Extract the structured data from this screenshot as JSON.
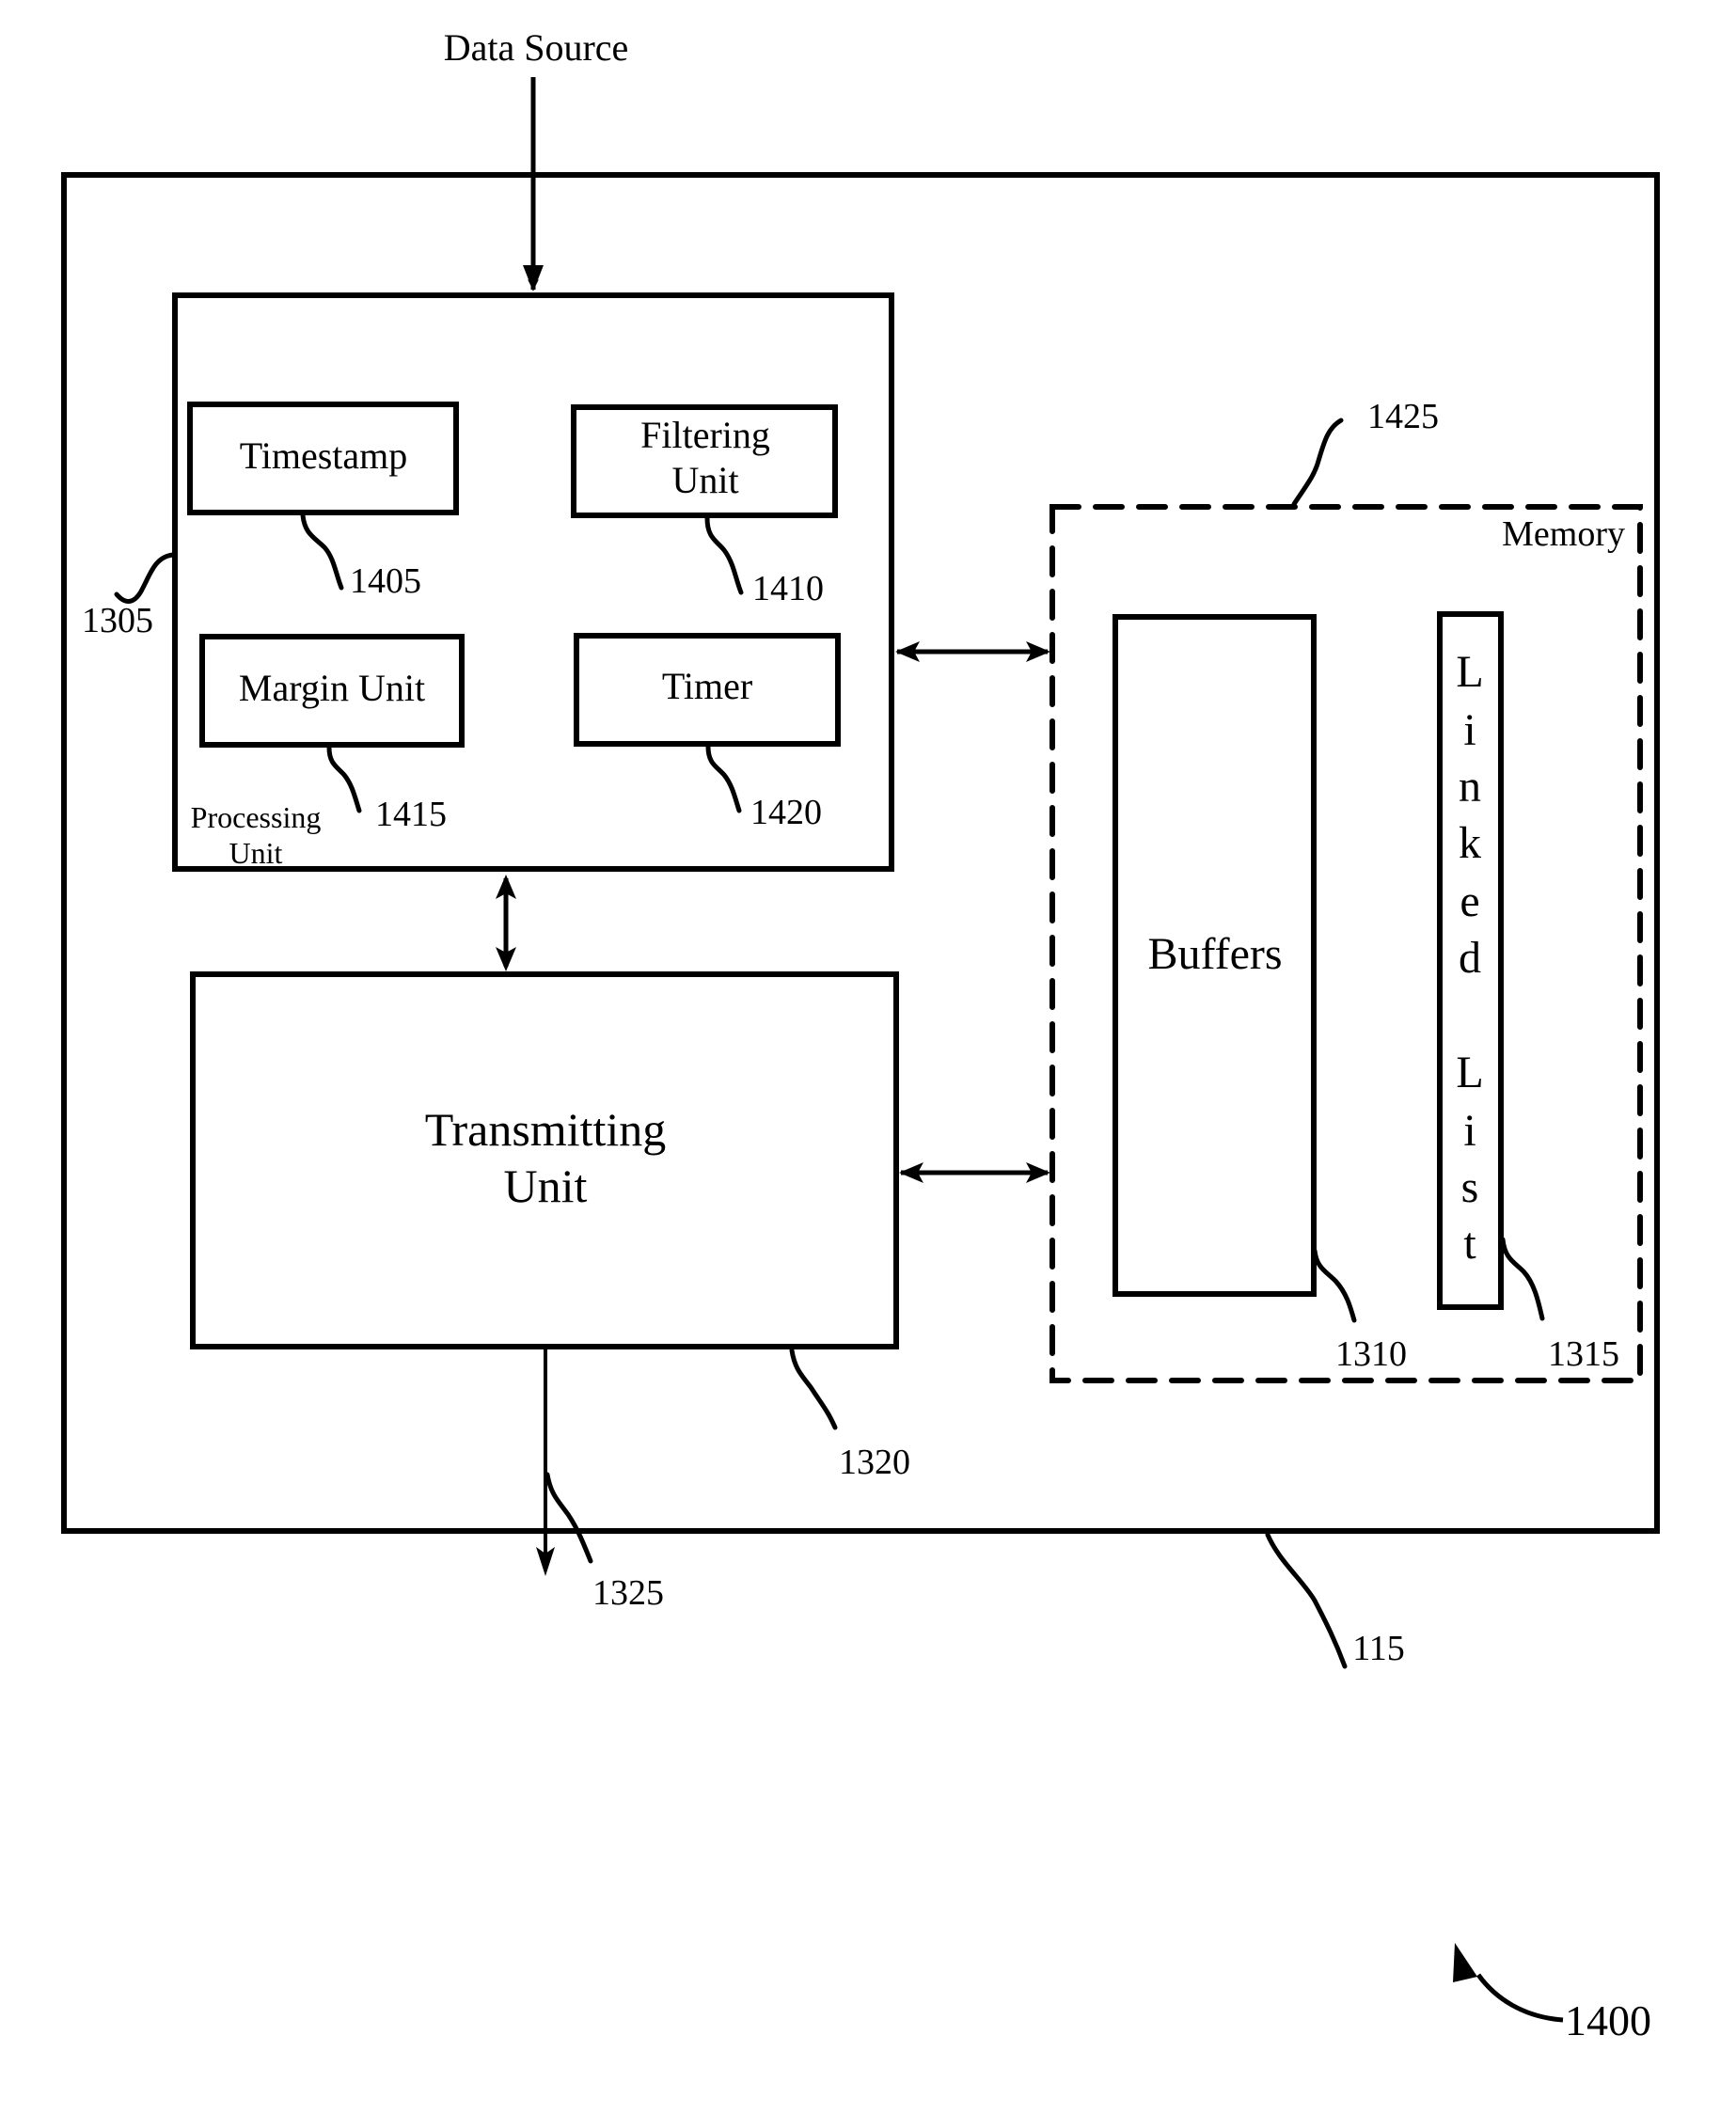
{
  "figure": {
    "number": "1400",
    "input_label": "Data Source",
    "outer_device": {
      "ref": "115"
    },
    "processing_unit": {
      "label_line1": "Processing",
      "label_line2": "Unit",
      "ref": "1305",
      "components": [
        {
          "name": "Timestamp",
          "ref": "1405"
        },
        {
          "name_line1": "Filtering",
          "name_line2": "Unit",
          "ref": "1410"
        },
        {
          "name": "Margin Unit",
          "ref": "1415"
        },
        {
          "name": "Timer",
          "ref": "1420"
        }
      ]
    },
    "transmitting_unit": {
      "label_line1": "Transmitting",
      "label_line2": "Unit",
      "ref": "1320"
    },
    "output": {
      "ref": "1325"
    },
    "memory": {
      "label": "Memory",
      "ref": "1425",
      "buffers": {
        "label": "Buffers",
        "ref": "1310"
      },
      "linked_list": {
        "letters": [
          "L",
          "i",
          "n",
          "k",
          "e",
          "d",
          "",
          "L",
          "i",
          "s",
          "t"
        ],
        "ref": "1315"
      }
    },
    "connections": [
      {
        "from": "Data Source",
        "to": "Processing Unit",
        "direction": "one-way"
      },
      {
        "from": "Processing Unit",
        "to": "Memory",
        "direction": "two-way"
      },
      {
        "from": "Processing Unit",
        "to": "Transmitting Unit",
        "direction": "two-way"
      },
      {
        "from": "Transmitting Unit",
        "to": "Memory",
        "direction": "two-way"
      },
      {
        "from": "Transmitting Unit",
        "to": "Output",
        "direction": "one-way"
      }
    ]
  }
}
